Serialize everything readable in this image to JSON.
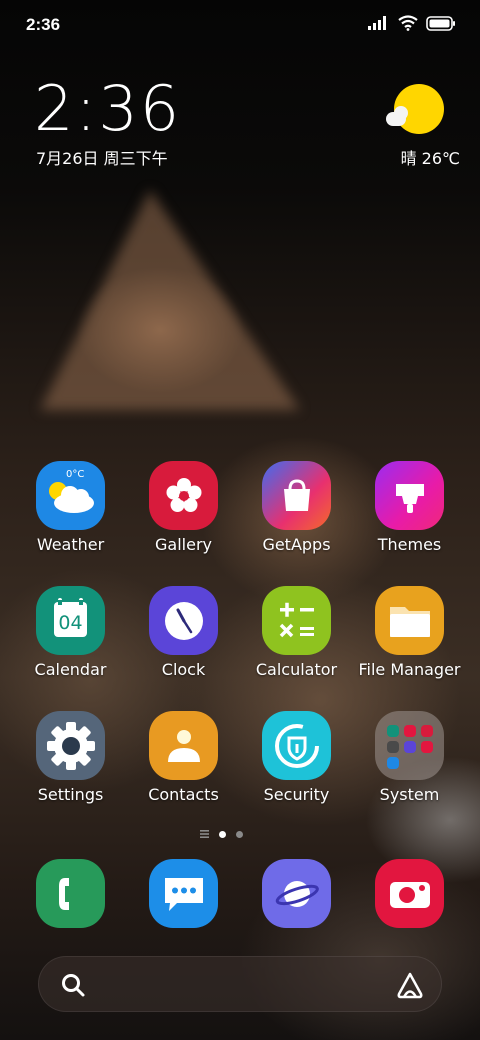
{
  "status_bar": {
    "time": "2:36",
    "icons": [
      "signal-icon",
      "wifi-icon",
      "battery-icon"
    ]
  },
  "clock_widget": {
    "time": "2:36",
    "date": "7月26日 周三下午"
  },
  "weather_widget": {
    "condition_temp": "晴 26℃",
    "icon": "sun-icon"
  },
  "apps": [
    {
      "label": "Weather",
      "icon": "weather-icon",
      "color": "#1e88e5",
      "badge": "0°C"
    },
    {
      "label": "Gallery",
      "icon": "flower-icon",
      "color": "#d81b3c"
    },
    {
      "label": "GetApps",
      "icon": "shopping-bag-icon",
      "color": "#ef3b5c"
    },
    {
      "label": "Themes",
      "icon": "paintbrush-icon",
      "color": "#d81bd0"
    },
    {
      "label": "Calendar",
      "icon": "calendar-icon",
      "color": "#12927a",
      "day": "04"
    },
    {
      "label": "Clock",
      "icon": "clock-icon",
      "color": "#5b45d8"
    },
    {
      "label": "Calculator",
      "icon": "calculator-icon",
      "color": "#8fc31f"
    },
    {
      "label": "File Manager",
      "icon": "folder-icon",
      "color": "#e8a21e"
    },
    {
      "label": "Settings",
      "icon": "gear-icon",
      "color": "#55667a"
    },
    {
      "label": "Contacts",
      "icon": "person-icon",
      "color": "#e89a22"
    },
    {
      "label": "Security",
      "icon": "shield-icon",
      "color": "#1ec2d8"
    },
    {
      "label": "System",
      "icon": "folder-grid-icon",
      "color": "#7f7a78"
    }
  ],
  "dock": [
    {
      "name": "phone",
      "icon": "phone-icon",
      "color": "#279a5a"
    },
    {
      "name": "messages",
      "icon": "chat-icon",
      "color": "#1d8ee8"
    },
    {
      "name": "browser",
      "icon": "planet-icon",
      "color": "#6f6be8"
    },
    {
      "name": "camera",
      "icon": "camera-icon",
      "color": "#e2163f"
    }
  ],
  "page_indicator": {
    "pages": 2,
    "current": 1
  },
  "search_bar": {
    "icon": "search-icon",
    "assistant_icon": "assistant-icon"
  }
}
